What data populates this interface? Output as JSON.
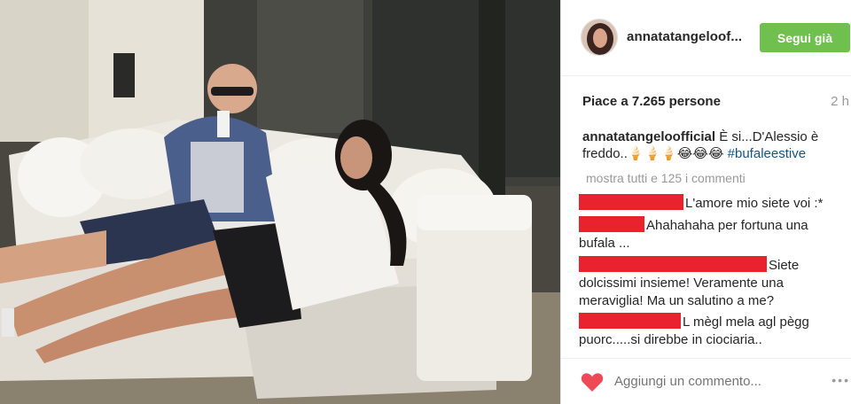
{
  "post": {
    "username": "annatatangeloof...",
    "follow_label": "Segui già",
    "likes_text": "Piace a 7.265 persone",
    "time": "2 h",
    "caption_user": "annatatangeloofficial",
    "caption_text": " È si...D'Alessio è freddo..🍦🍦🍦😂😂😂 ",
    "caption_hashtag": "#bufaleestive",
    "more_comments": "mostra tutti e 125 i commenti"
  },
  "comments": [
    {
      "text": "L'amore mio siete voi :*"
    },
    {
      "text": "Ahahahaha per fortuna una bufala ..."
    },
    {
      "text": "Siete dolcissimi insieme! Veramente una meraviglia! Ma un salutino a me?"
    },
    {
      "text": "L mègl mela agl pègg puorc.....si direbbe in ciociaria.."
    }
  ],
  "footer": {
    "add_comment_placeholder": "Aggiungi un commento...",
    "more_options": "•••"
  },
  "colors": {
    "follow_button": "#70c050",
    "heart": "#ed4956",
    "redaction": "#e8232e",
    "hashtag": "#125688"
  },
  "icons": [
    "heart-icon",
    "more-options-icon"
  ]
}
